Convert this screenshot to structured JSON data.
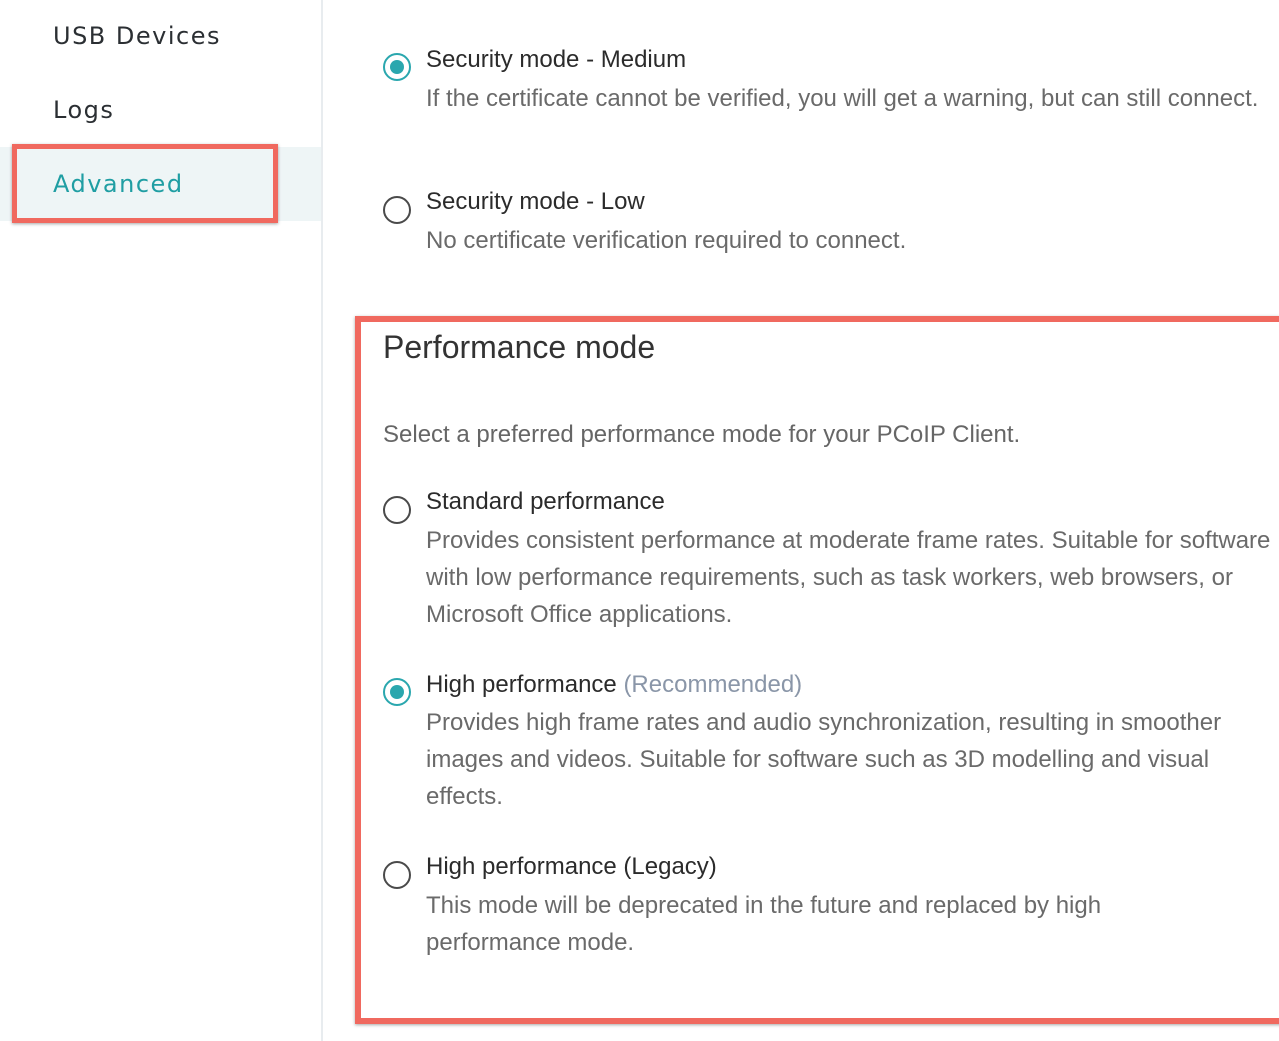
{
  "sidebar": {
    "items": [
      {
        "label": "USB Devices"
      },
      {
        "label": "Logs"
      },
      {
        "label": "Advanced",
        "selected": true
      }
    ]
  },
  "security": {
    "options": [
      {
        "title": "Security mode - Medium",
        "description": "If the certificate cannot be verified, you will get a warning, but can still connect.",
        "selected": true
      },
      {
        "title": "Security mode - Low",
        "description": "No certificate verification required to connect.",
        "selected": false
      }
    ]
  },
  "performance": {
    "title": "Performance mode",
    "description": "Select a preferred performance mode for your PCoIP Client.",
    "options": [
      {
        "title": "Standard performance",
        "tag": "",
        "description": "Provides consistent performance at moderate frame rates. Suitable for software with low performance requirements, such as task workers, web browsers, or Microsoft Office applications.",
        "selected": false
      },
      {
        "title": "High performance",
        "tag": "(Recommended)",
        "description": "Provides high frame rates and audio synchronization, resulting in smoother images and videos. Suitable for software such as 3D modelling and visual effects.",
        "selected": true
      },
      {
        "title": "High performance (Legacy)",
        "tag": "",
        "description": "This mode will be deprecated in the future and replaced by high performance mode.",
        "selected": false
      }
    ]
  },
  "colors": {
    "accent": "#2aa7ae",
    "highlight": "#f0695f",
    "selected_nav_bg": "#eef5f6"
  }
}
